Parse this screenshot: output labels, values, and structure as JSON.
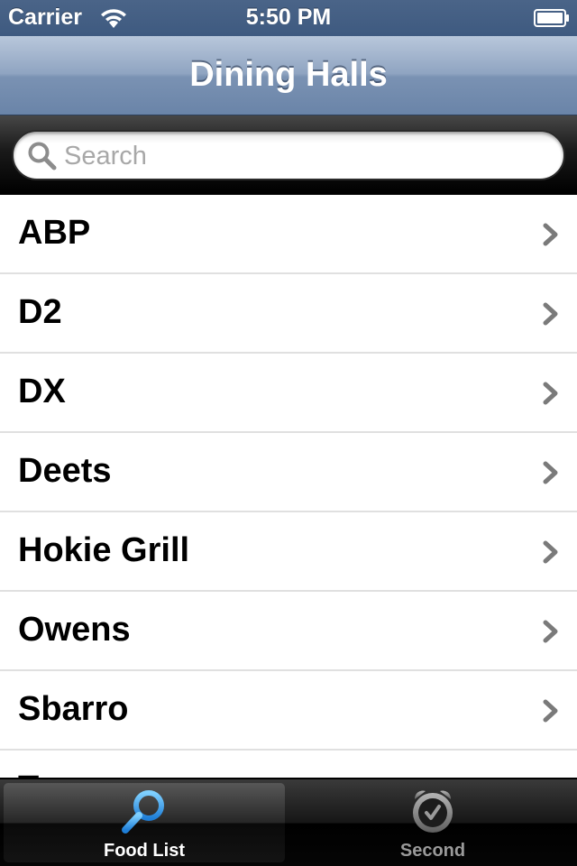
{
  "status_bar": {
    "carrier": "Carrier",
    "time": "5:50 PM"
  },
  "nav": {
    "title": "Dining Halls"
  },
  "search": {
    "placeholder": "Search",
    "value": ""
  },
  "list": {
    "items": [
      {
        "label": "ABP"
      },
      {
        "label": "D2"
      },
      {
        "label": "DX"
      },
      {
        "label": "Deets"
      },
      {
        "label": "Hokie Grill"
      },
      {
        "label": "Owens"
      },
      {
        "label": "Sbarro"
      },
      {
        "label": "T"
      }
    ]
  },
  "tab_bar": {
    "tabs": [
      {
        "label": "Food List",
        "icon": "magnifier-icon",
        "selected": true
      },
      {
        "label": "Second",
        "icon": "alarm-clock-icon",
        "selected": false
      }
    ]
  },
  "colors": {
    "status_bar": "#445f85",
    "nav_bar": "#7e95b5",
    "tab_selected": "#2f9bea",
    "tab_unselected": "#9a9a9a"
  }
}
